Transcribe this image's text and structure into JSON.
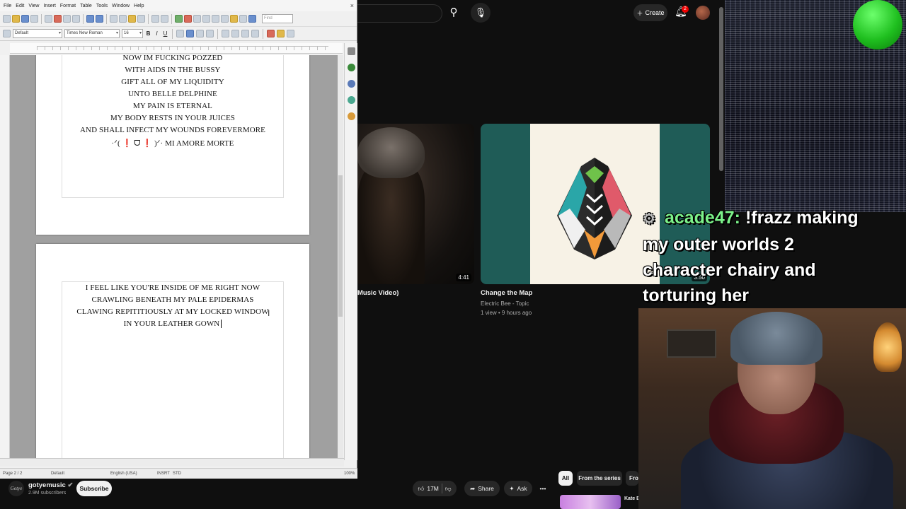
{
  "writer": {
    "menu": [
      "File",
      "Edit",
      "View",
      "Insert",
      "Format",
      "Table",
      "Tools",
      "Window",
      "Help"
    ],
    "find_placeholder": "Find",
    "style_value": "Default",
    "font_value": "Times New Roman",
    "size_value": "16",
    "format_bold": "B",
    "format_italic": "I",
    "format_underline": "U",
    "page1_lines": [
      "NOW IM FUCKING POZZED",
      "WITH AIDS IN THE BUSSY",
      "GIFT ALL OF MY LIQUIDITY",
      "UNTO BELLE DELPHINE",
      "MY PAIN IS ETERNAL",
      "MY BODY RESTS IN YOUR JUICES",
      "AND SHALL INFECT MY WOUNDS FOREVERMORE",
      "·ᐟ( ❗ ᗜ ❗ )ᐟ·  MI AMORE MORTE"
    ],
    "page2_lines": [
      "I FEEL LIKE YOU'RE INSIDE OF ME RIGHT NOW",
      "CRAWLING BENEATH MY PALE EPIDERMAS",
      "CLAWING REPITITIOUSLY AT MY LOCKED WINDOW",
      "IN YOUR LEATHER GOWN"
    ],
    "status": {
      "page": "Page 2 / 2",
      "style": "Default",
      "language": "English (USA)",
      "mode": "INSRT",
      "sel": "STD",
      "zoom": "100%"
    }
  },
  "youtube": {
    "create_label": "Create",
    "notif_count": "2",
    "video1": {
      "duration": "4:41",
      "title": "Music Video)"
    },
    "video2": {
      "duration": "3:50",
      "title": "Change the Map",
      "channel": "Electric Bee - Topic",
      "meta": "1 view • 9 hours ago"
    },
    "channel": {
      "logo": "Gotye",
      "name": "gotyemusic",
      "subs": "2.9M subscribers",
      "subscribe_label": "Subscribe"
    },
    "actions": {
      "likes": "17M",
      "share": "Share",
      "ask": "Ask",
      "more": "•••"
    },
    "chips": [
      "All",
      "From the series",
      "From"
    ],
    "mini_text": "Kate B Hill"
  },
  "stream": {
    "chat_user": "acade47:",
    "chat_lines": [
      "!frazz making",
      "my outer worlds 2",
      "character chairy and",
      "torturing her"
    ]
  }
}
